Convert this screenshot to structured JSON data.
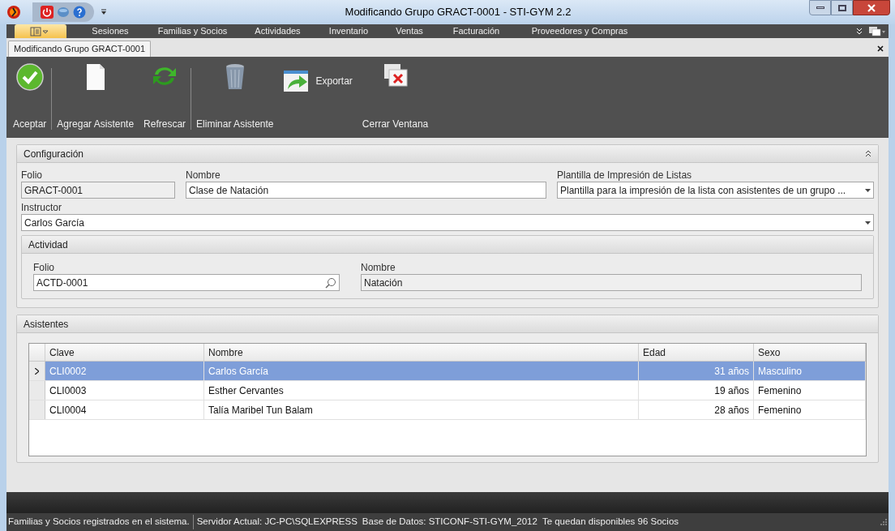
{
  "window": {
    "title": "Modificando Grupo GRACT-0001 - STI-GYM 2.2"
  },
  "menu": [
    {
      "label": "Sesiones"
    },
    {
      "label": "Familias y Socios"
    },
    {
      "label": "Actividades"
    },
    {
      "label": "Inventario"
    },
    {
      "label": "Ventas"
    },
    {
      "label": "Facturación"
    },
    {
      "label": "Proveedores y Compras"
    }
  ],
  "document_tab": {
    "label": "Modificando Grupo GRACT-0001",
    "selected": true
  },
  "toolbar": [
    {
      "kind": "ok",
      "label": "Aceptar"
    },
    {
      "kind": "new",
      "label": "Agregar Asistente"
    },
    {
      "kind": "refresh",
      "label": "Refrescar"
    },
    {
      "kind": "delete",
      "label": "Eliminar Asistente"
    },
    {
      "kind": "export",
      "label": "Exportar"
    },
    {
      "kind": "close",
      "label": "Cerrar Ventana"
    }
  ],
  "configuracion": {
    "title": "Configuración",
    "folio_label": "Folio",
    "folio": "GRACT-0001",
    "nombre_label": "Nombre",
    "nombre": "Clase de Natación",
    "plantilla_label": "Plantilla de Impresión de Listas",
    "plantilla": "Plantilla para la impresión de la lista con asistentes de un grupo ...",
    "instructor_label": "Instructor",
    "instructor": "Carlos García",
    "actividad": {
      "title": "Actividad",
      "folio_label": "Folio",
      "folio": "ACTD-0001",
      "nombre_label": "Nombre",
      "nombre": "Natación"
    }
  },
  "asistentes": {
    "title": "Asistentes",
    "columns": [
      "Clave",
      "Nombre",
      "Edad",
      "Sexo"
    ],
    "rows": [
      {
        "clave": "CLI0002",
        "nombre": "Carlos García",
        "edad": "31 años",
        "sexo": "Masculino",
        "selected": true
      },
      {
        "clave": "CLI0003",
        "nombre": "Esther Cervantes",
        "edad": "19 años",
        "sexo": "Femenino",
        "selected": false
      },
      {
        "clave": "CLI0004",
        "nombre": "Talía Maribel Tun Balam",
        "edad": "28 años",
        "sexo": "Femenino",
        "selected": false
      }
    ]
  },
  "status_bar": [
    "Familias y Socios registrados en el sistema.",
    "Servidor Actual: JC-PC\\SQLEXPRESS",
    "Base de Datos: STICONF-STI-GYM_2012",
    "Te quedan disponibles 96 Socios"
  ]
}
